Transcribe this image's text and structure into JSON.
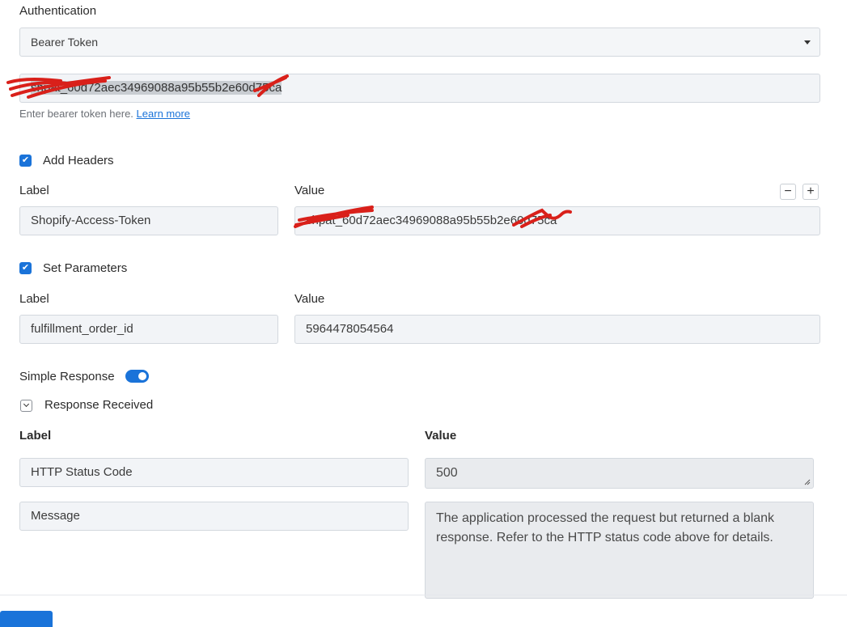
{
  "auth": {
    "label": "Authentication",
    "type_value": "Bearer Token",
    "token_value": "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",
    "hint": "Enter bearer token here.",
    "hint_link": "Learn more"
  },
  "headers": {
    "checkbox_label": "Add Headers",
    "label_col": "Label",
    "value_col": "Value",
    "minus": "−",
    "plus": "+",
    "row_label": "Shopify-Access-Token",
    "row_value": "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"
  },
  "params": {
    "checkbox_label": "Set Parameters",
    "label_col": "Label",
    "value_col": "Value",
    "row_label": "fulfillment_order_id",
    "row_value": "5964478054564"
  },
  "simple_response": {
    "label": "Simple Response",
    "enabled": true
  },
  "response": {
    "section_label": "Response Received",
    "label_col": "Label",
    "value_col": "Value",
    "rows": [
      {
        "label": "HTTP Status Code",
        "value": "500"
      },
      {
        "label": "Message",
        "value": "The application processed the request but returned a blank response.  Refer to the HTTP status code above for details."
      }
    ]
  },
  "colors": {
    "accent": "#1a73d9",
    "redaction": "#d9201a"
  }
}
